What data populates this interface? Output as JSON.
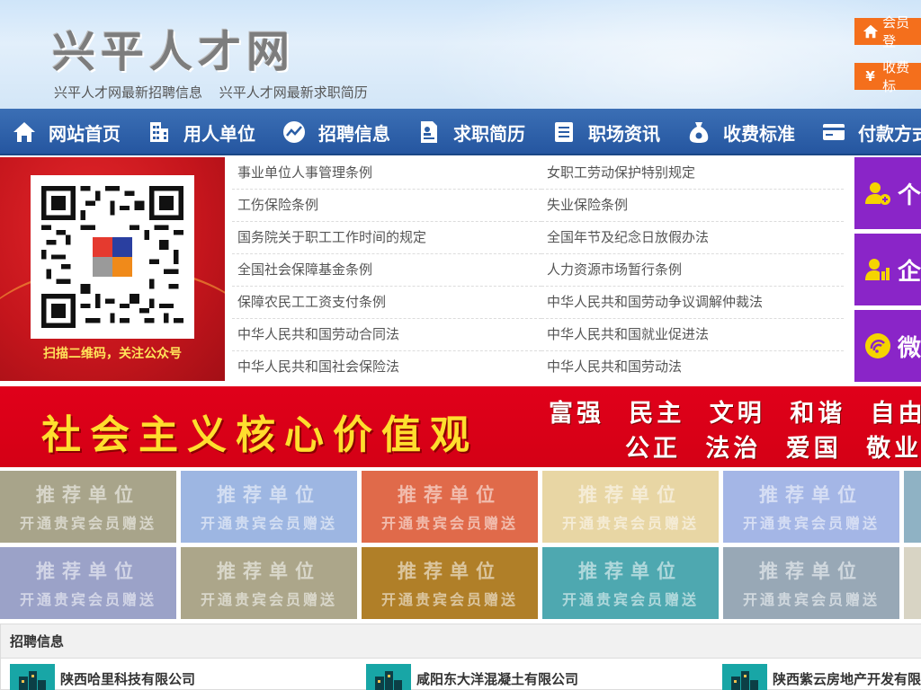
{
  "header": {
    "logo": "兴平人才网",
    "links": [
      "兴平人才网最新招聘信息",
      "兴平人才网最新求职简历"
    ],
    "login_label": "会员登",
    "fee_label": "收费标",
    "fee_symbol": "¥"
  },
  "nav": [
    {
      "label": "网站首页",
      "icon": "home-icon"
    },
    {
      "label": "用人单位",
      "icon": "building-icon"
    },
    {
      "label": "招聘信息",
      "icon": "chart-icon"
    },
    {
      "label": "求职简历",
      "icon": "resume-icon"
    },
    {
      "label": "职场资讯",
      "icon": "news-icon"
    },
    {
      "label": "收费标准",
      "icon": "money-bag-icon"
    },
    {
      "label": "付款方式",
      "icon": "card-icon"
    }
  ],
  "qr": {
    "caption": "扫描二维码，关注公众号"
  },
  "regulations": [
    "事业单位人事管理条例",
    "女职工劳动保护特别规定",
    "工伤保险条例",
    "失业保险条例",
    "国务院关于职工工作时间的规定",
    "全国年节及纪念日放假办法",
    "全国社会保障基金条例",
    "人力资源市场暂行条例",
    "保障农民工工资支付条例",
    "中华人民共和国劳动争议调解仲裁法",
    "中华人民共和国劳动合同法",
    "中华人民共和国就业促进法",
    "中华人民共和国社会保险法",
    "中华人民共和国劳动法"
  ],
  "side_tiles": [
    {
      "label": "个",
      "icon": "person-add-icon"
    },
    {
      "label": "企",
      "icon": "company-person-icon"
    },
    {
      "label": "微",
      "icon": "wechat-icon"
    }
  ],
  "banner": {
    "main": "社会主义核心价值观",
    "row1": "富强 民主 文明 和谐 自由",
    "row2": "公正 法治 爱国 敬业"
  },
  "recommended": {
    "title": "推荐单位",
    "subtitle": "开通贵宾会员赠送",
    "colors": [
      "#a8a48a",
      "#9db6e2",
      "#e06a4a",
      "#e8d6a4",
      "#a4b6e6",
      "#8fb2c4",
      "#9ba2c8",
      "#aca68a",
      "#b07f28",
      "#4ea8b0",
      "#98a8b6",
      "#d8d4c4"
    ]
  },
  "jobs": {
    "heading": "招聘信息",
    "items": [
      "陕西哈里科技有限公司",
      "咸阳东大洋混凝土有限公司",
      "陕西紫云房地产开发有限"
    ]
  },
  "colors": {
    "nav_blue": "#2b5ea6",
    "accent_orange": "#f46f1c",
    "tile_purple": "#8a25c8",
    "banner_red": "#e0001a",
    "banner_yellow": "#ffde2e"
  }
}
